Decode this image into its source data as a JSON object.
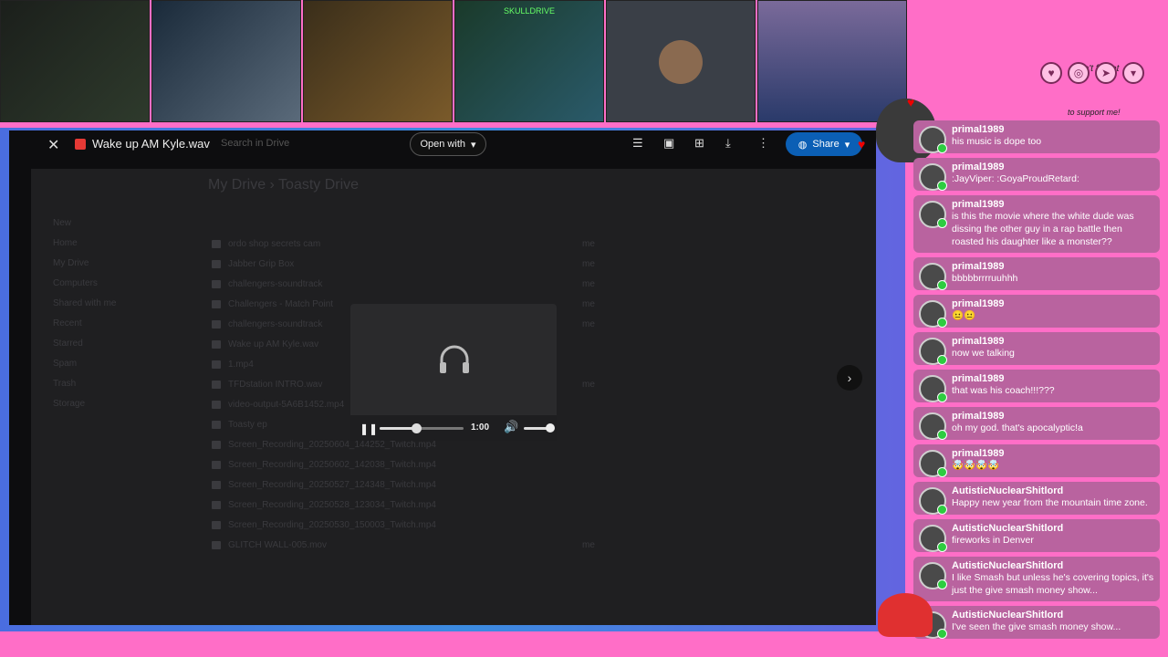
{
  "cams": [
    {
      "label": ""
    },
    {
      "label": ""
    },
    {
      "label": ""
    },
    {
      "label": "SKULLDRIVE"
    },
    {
      "label": ""
    },
    {
      "label": ""
    }
  ],
  "overlay": {
    "dont_forget": "Don't forget",
    "support": "to support me!"
  },
  "drive": {
    "file_name": "Wake up AM Kyle.wav",
    "search_placeholder": "Search in Drive",
    "open_with": "Open with",
    "share": "Share",
    "breadcrumb": "My Drive  ›  Toasty Drive",
    "sidebar": [
      "New",
      "Home",
      "My Drive",
      "Computers",
      "Shared with me",
      "Recent",
      "Starred",
      "Spam",
      "Trash",
      "Storage"
    ],
    "rows": [
      {
        "name": "ordo shop secrets cam",
        "owner": "me"
      },
      {
        "name": "Jabber Grip Box",
        "owner": "me"
      },
      {
        "name": "challengers-soundtrack",
        "owner": "me"
      },
      {
        "name": "Challengers - Match Point",
        "owner": "me"
      },
      {
        "name": "challengers-soundtrack",
        "owner": "me"
      },
      {
        "name": "Wake up AM Kyle.wav",
        "owner": ""
      },
      {
        "name": "1.mp4",
        "owner": ""
      },
      {
        "name": "TFDstation INTRO.wav",
        "owner": "me"
      },
      {
        "name": "video-output-5A6B1452.mp4",
        "owner": ""
      },
      {
        "name": "Toasty ep",
        "owner": ""
      },
      {
        "name": "Screen_Recording_20250604_144252_Twitch.mp4",
        "owner": ""
      },
      {
        "name": "Screen_Recording_20250602_142038_Twitch.mp4",
        "owner": ""
      },
      {
        "name": "Screen_Recording_20250527_124348_Twitch.mp4",
        "owner": ""
      },
      {
        "name": "Screen_Recording_20250528_123034_Twitch.mp4",
        "owner": ""
      },
      {
        "name": "Screen_Recording_20250530_150003_Twitch.mp4",
        "owner": ""
      },
      {
        "name": "GLITCH WALL-005.mov",
        "owner": "me"
      }
    ]
  },
  "player": {
    "time": "1:00",
    "progress": 0.43
  },
  "chat": [
    {
      "user": "primal1989",
      "text": "his music is dope too"
    },
    {
      "user": "primal1989",
      "text": ":JayViper: :GoyaProudRetard:"
    },
    {
      "user": "primal1989",
      "text": "is this the movie where the white dude was dissing the other guy in a rap battle then roasted his daughter like a monster??"
    },
    {
      "user": "primal1989",
      "text": "bbbbbrrrruuhhh"
    },
    {
      "user": "primal1989",
      "text": "😐😐"
    },
    {
      "user": "primal1989",
      "text": "now we talking"
    },
    {
      "user": "primal1989",
      "text": "that was his coach!!!???"
    },
    {
      "user": "primal1989",
      "text": "oh my god. that's apocalyptic!a"
    },
    {
      "user": "primal1989",
      "text": "🤯🤯🤯🤯"
    },
    {
      "user": "AutisticNuclearShitlord",
      "text": "Happy new year from the mountain time zone."
    },
    {
      "user": "AutisticNuclearShitlord",
      "text": "fireworks in Denver"
    },
    {
      "user": "AutisticNuclearShitlord",
      "text": "I like Smash but unless he's covering topics, it's just the give smash money show..."
    },
    {
      "user": "AutisticNuclearShitlord",
      "text": "I've seen the give smash money show..."
    }
  ]
}
